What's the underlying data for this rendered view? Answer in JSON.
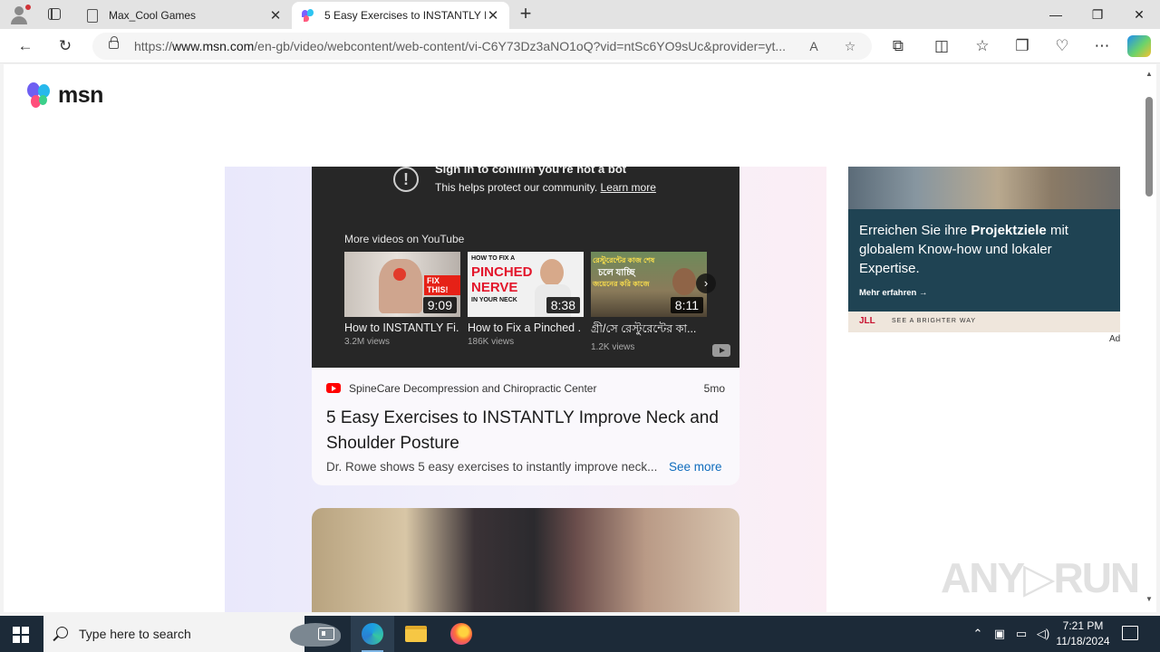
{
  "browser": {
    "tabs": [
      {
        "title": "Max_Cool Games",
        "active": false
      },
      {
        "title": "5 Easy Exercises to INSTANTLY Im",
        "active": true
      }
    ],
    "address": {
      "scheme": "https://",
      "host": "www.msn.com",
      "path": "/en-gb/video/webcontent/web-content/vi-C6Y73Dz3aNO1oQ?vid=ntSc6YO9sUc&provider=yt..."
    },
    "window_controls": {
      "minimize": "—",
      "restore": "❐",
      "close": "✕"
    }
  },
  "page": {
    "logo_text": "msn",
    "player": {
      "signin_title": "Sign in to confirm you're not a bot",
      "signin_sub": "This helps protect our community.",
      "learn_more": "Learn more",
      "more_videos": "More videos on YouTube",
      "videos": [
        {
          "title": "How to INSTANTLY Fi...",
          "views": "3.2M views",
          "duration": "9:09"
        },
        {
          "title": "How to Fix a Pinched ...",
          "views": "186K views",
          "duration": "8:38"
        },
        {
          "title": "গ্রী/সে রেস্টুরেন্টের কা...",
          "views": "1.2K views",
          "duration": "8:11"
        }
      ],
      "thumb_overlays": {
        "fix_this": "FIX THIS!",
        "pinched_line1": "HOW TO FIX A",
        "pinched_line2": "PINCHED",
        "pinched_line3": "NERVE",
        "pinched_line4": "IN YOUR NECK",
        "bengali_line1": "রেস্টুরেন্টের কাজ শেষ",
        "bengali_line2": "চলে যাচ্ছি",
        "bengali_line3": "জয়েনের করি কাজে"
      }
    },
    "provider": "SpineCare Decompression and Chiropractic Center",
    "age": "5mo",
    "video_title": "5 Easy Exercises to INSTANTLY Improve Neck and Shoulder Posture",
    "description": "Dr. Rowe shows 5 easy exercises to instantly improve neck...",
    "see_more": "See more",
    "ad": {
      "headline_pre": "Erreichen Sie ihre ",
      "headline_bold": "Projektziele",
      "headline_post": " mit globalem Know-how und lokaler Expertise.",
      "cta": "Mehr erfahren →",
      "brand": "JLL",
      "tagline": "SEE A BRIGHTER WAY",
      "label": "Ad"
    },
    "watermark": "ANY▷RUN"
  },
  "taskbar": {
    "search_placeholder": "Type here to search",
    "time": "7:21 PM",
    "date": "11/18/2024"
  },
  "colors": {
    "accent_link": "#0f6cbd",
    "player_bg": "#272727",
    "ad_bg": "#1f4353",
    "taskbar_bg": "#1c2a38"
  }
}
